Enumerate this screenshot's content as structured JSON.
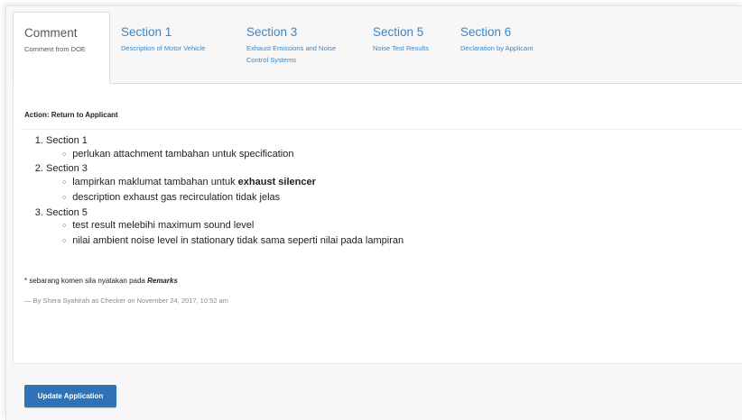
{
  "tabs": [
    {
      "title": "Comment",
      "subtitle": "Comment from DOE"
    },
    {
      "title": "Section 1",
      "subtitle": "Description of Motor Vehicle"
    },
    {
      "title": "Section 3",
      "subtitle": "Exhaust Emissions and Noise Control Systems"
    },
    {
      "title": "Section 5",
      "subtitle": "Noise Test Results"
    },
    {
      "title": "Section 6",
      "subtitle": "Declaration by Applicant"
    }
  ],
  "comment": {
    "action_label": "Action: Return to Applicant",
    "sections": [
      {
        "label": "Section 1",
        "items": [
          {
            "text": "perlukan attachment tambahan untuk specification"
          }
        ]
      },
      {
        "label": "Section 3",
        "items": [
          {
            "text": "lampirkan maklumat tambahan untuk ",
            "bold": "exhaust silencer"
          },
          {
            "text": "description exhaust gas recirculation tidak jelas"
          }
        ]
      },
      {
        "label": "Section 5",
        "items": [
          {
            "text": "test result melebihi maximum sound level"
          },
          {
            "text": "nilai ambient noise level in stationary tidak sama seperti nilai pada lampiran"
          }
        ]
      }
    ],
    "note_prefix": "* sebarang komen sila nyatakan pada ",
    "note_emphasis": "Remarks",
    "byline": "— By Shera Syahirah as Checker on November 24, 2017, 10:52 am"
  },
  "update_button_label": "Update Application",
  "colors": {
    "link": "#3a87c8",
    "button": "#2f73b6"
  }
}
